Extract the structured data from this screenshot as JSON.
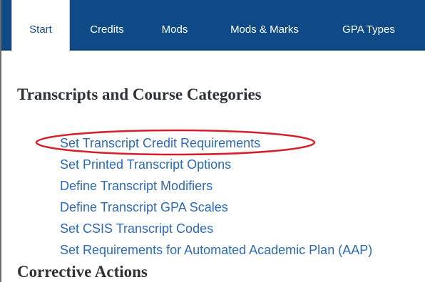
{
  "tabs": [
    {
      "label": "Start",
      "active": true
    },
    {
      "label": "Credits",
      "active": false
    },
    {
      "label": "Mods",
      "active": false
    },
    {
      "label": "Mods & Marks",
      "active": false
    },
    {
      "label": "GPA Types",
      "active": false
    }
  ],
  "sections": {
    "transcripts": {
      "heading": "Transcripts and Course Categories",
      "links": [
        "Set Transcript Credit Requirements",
        "Set Printed Transcript Options",
        "Define Transcript Modifiers",
        "Define Transcript GPA Scales",
        "Set CSIS Transcript Codes",
        "Set Requirements for Automated Academic Plan (AAP)"
      ]
    },
    "corrective": {
      "heading": "Corrective Actions"
    }
  },
  "colors": {
    "tabbar": "#0d4a86",
    "link": "#2e6ab5",
    "highlight": "#d4202a"
  }
}
